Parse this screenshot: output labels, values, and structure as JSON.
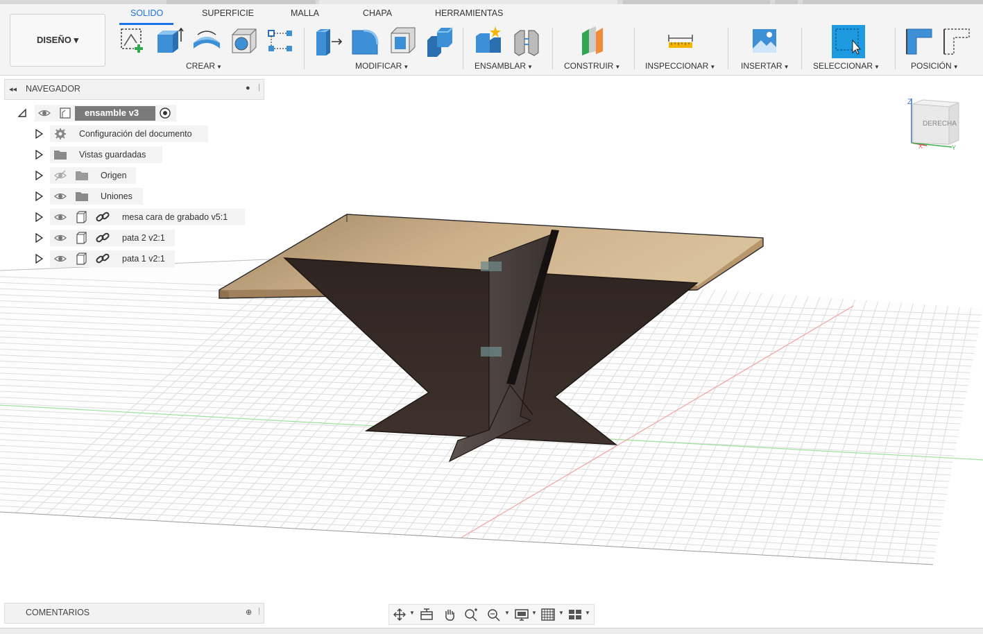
{
  "toolbar": {
    "workspace_label": "DISEÑO ▾",
    "tabs": [
      "SOLIDO",
      "SUPERFICIE",
      "MALLA",
      "CHAPA",
      "HERRAMIENTAS"
    ],
    "groups": [
      "CREAR",
      "MODIFICAR",
      "ENSAMBLAR",
      "CONSTRUIR",
      "INSPECCIONAR",
      "INSERTAR",
      "SELECCIONAR",
      "POSICIÓN"
    ]
  },
  "navigator": {
    "title": "NAVEGADOR",
    "root": "ensamble v3",
    "items": [
      {
        "label": "Configuración del documento",
        "icon": "gear-icon"
      },
      {
        "label": "Vistas guardadas",
        "icon": "folder-icon"
      },
      {
        "label": "Origen",
        "icon": "folder-icon",
        "visibility": "hidden"
      },
      {
        "label": "Uniones",
        "icon": "folder-icon",
        "visibility": "visible"
      },
      {
        "label": "mesa cara de grabado v5:1",
        "icon": "component-link-icon",
        "visibility": "visible"
      },
      {
        "label": "pata 2 v2:1",
        "icon": "component-link-icon",
        "visibility": "visible"
      },
      {
        "label": "pata 1 v2:1",
        "icon": "component-link-icon",
        "visibility": "visible"
      }
    ]
  },
  "viewcube": {
    "face_label": "DERECHA",
    "axis_z": "Z",
    "axis_x": "X",
    "axis_y": "Y"
  },
  "comments": {
    "title": "COMENTARIOS"
  },
  "colors": {
    "accent": "#1a73e8",
    "tabletop": "#d1b489",
    "legs": "#3a2e29",
    "select_blue": "#1e9be0"
  }
}
